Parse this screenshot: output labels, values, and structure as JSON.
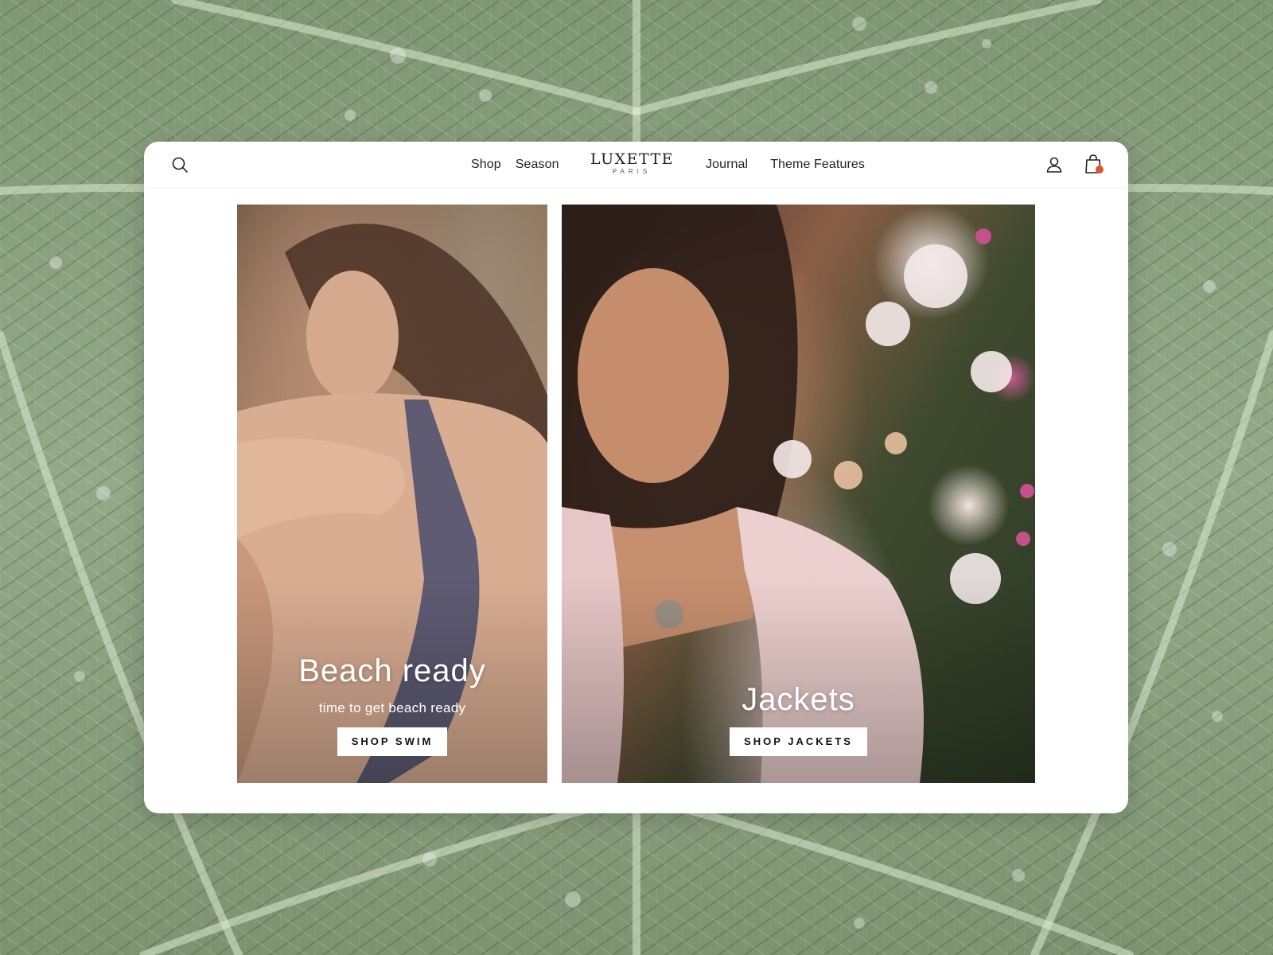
{
  "brand": {
    "name": "LUXETTE",
    "tagline": "PARIS"
  },
  "nav": {
    "left": [
      "Shop",
      "Season"
    ],
    "right": [
      "Journal",
      "Theme Features"
    ]
  },
  "header_icons": {
    "search": "search-icon",
    "account": "user-icon",
    "cart": "shopping-bag-icon",
    "cart_badge_color": "#e4532f"
  },
  "banners": [
    {
      "title": "Beach ready",
      "subtitle": "time to get beach ready",
      "cta": "SHOP SWIM"
    },
    {
      "title": "Jackets",
      "cta": "SHOP JACKETS"
    }
  ],
  "colors": {
    "background_leaf": "#8fa585",
    "card": "#ffffff",
    "text": "#222222"
  }
}
